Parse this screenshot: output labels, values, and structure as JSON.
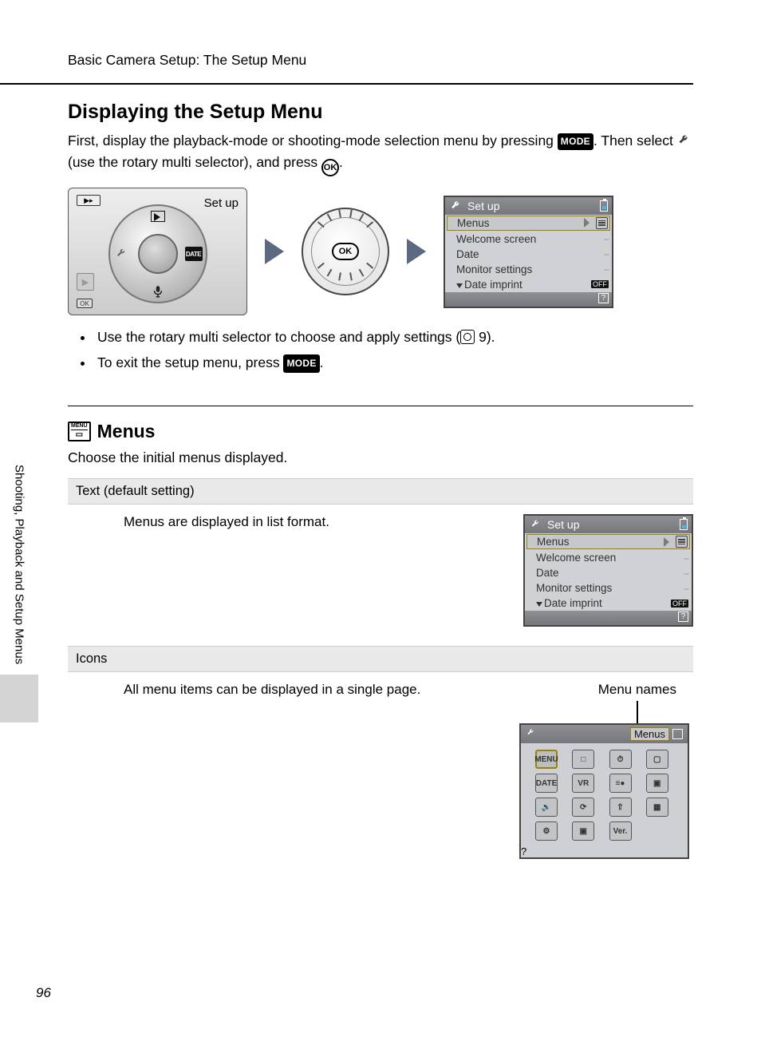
{
  "header": "Basic Camera Setup: The Setup Menu",
  "h1": "Displaying the Setup Menu",
  "intro_1a": "First, display the playback-mode or shooting-mode selection menu by pressing ",
  "intro_1b": ". Then select ",
  "intro_1c": " (use the rotary multi selector), and press ",
  "intro_1d": ".",
  "panel_label": "Set up",
  "ok_label": "OK",
  "mode_label": "MODE",
  "lcd1": {
    "title": "Set up",
    "items": [
      {
        "label": "Menus",
        "kind": "list"
      },
      {
        "label": "Welcome screen",
        "kind": "dash"
      },
      {
        "label": "Date",
        "kind": "dash"
      },
      {
        "label": "Monitor settings",
        "kind": "dash"
      },
      {
        "label": "Date imprint",
        "kind": "off",
        "arrow": true
      }
    ],
    "off_label": "OFF",
    "help": "?"
  },
  "bullet1a": "Use the rotary multi selector to choose and apply settings (",
  "bullet1b": " 9).",
  "bullet2a": "To exit the setup menu, press ",
  "bullet2b": ".",
  "h2": "Menus",
  "h2_desc": "Choose the initial menus displayed.",
  "opt_text": {
    "header": "Text (default setting)",
    "body": "Menus are displayed in list format."
  },
  "opt_icons": {
    "header": "Icons",
    "body": "All menu items can be displayed in a single page.",
    "menu_names": "Menu names",
    "grid_title": "Menus",
    "grid": [
      "MENU",
      "□",
      "⏱",
      "▢",
      "DATE",
      "VR",
      "≡●",
      "▣",
      "🔊",
      "⟳",
      "⇧",
      "▦",
      "⚙",
      "▣",
      "Ver.",
      ""
    ]
  },
  "sidebar": "Shooting, Playback and Setup Menus",
  "page": "96"
}
